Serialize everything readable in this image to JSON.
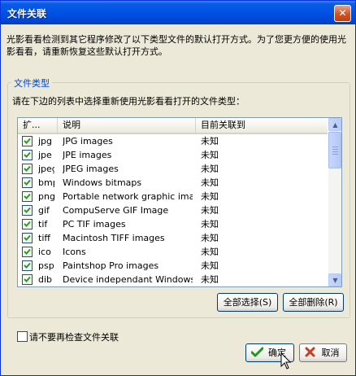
{
  "window": {
    "title": "文件关联",
    "close_symbol": "✕"
  },
  "description": "光影看看检测到其它程序修改了以下类型文件的默认打开方式。为了您更方便的使用光影看看，请重新恢复这些默认打开方式。",
  "group": {
    "legend": "文件类型",
    "prompt": "请在下边的列表中选择重新使用光影看看打开的文件类型："
  },
  "list": {
    "columns": [
      "扩...",
      "说明",
      "目前关联到"
    ],
    "rows": [
      {
        "ext": "jpg",
        "desc": "JPG images",
        "assoc": "未知",
        "checked": true
      },
      {
        "ext": "jpe",
        "desc": "JPE images",
        "assoc": "未知",
        "checked": true
      },
      {
        "ext": "jpeg",
        "desc": "JPEG images",
        "assoc": "未知",
        "checked": true
      },
      {
        "ext": "bmp",
        "desc": "Windows bitmaps",
        "assoc": "未知",
        "checked": true
      },
      {
        "ext": "png",
        "desc": "Portable network graphic images",
        "assoc": "未知",
        "checked": true
      },
      {
        "ext": "gif",
        "desc": "CompuServe GIF Image",
        "assoc": "未知",
        "checked": true
      },
      {
        "ext": "tif",
        "desc": "PC TIF images",
        "assoc": "未知",
        "checked": true
      },
      {
        "ext": "tiff",
        "desc": "Macintosh TIFF images",
        "assoc": "未知",
        "checked": true
      },
      {
        "ext": "ico",
        "desc": "Icons",
        "assoc": "未知",
        "checked": true
      },
      {
        "ext": "psp",
        "desc": "Paintshop Pro images",
        "assoc": "未知",
        "checked": true
      },
      {
        "ext": "dib",
        "desc": "Device independant Windows ...",
        "assoc": "未知",
        "checked": true
      }
    ]
  },
  "buttons": {
    "select_all": "全部选择(S)",
    "delete_all": "全部删除(R)",
    "ok": "确定",
    "cancel": "取消"
  },
  "dont_check_label": "请不要再检查文件关联",
  "colors": {
    "title_bar": "#0055e5",
    "legend_text": "#0046d5",
    "check_mark": "#21a121",
    "ok_icon": "#1f9a1f",
    "cancel_icon": "#d03a1e"
  }
}
